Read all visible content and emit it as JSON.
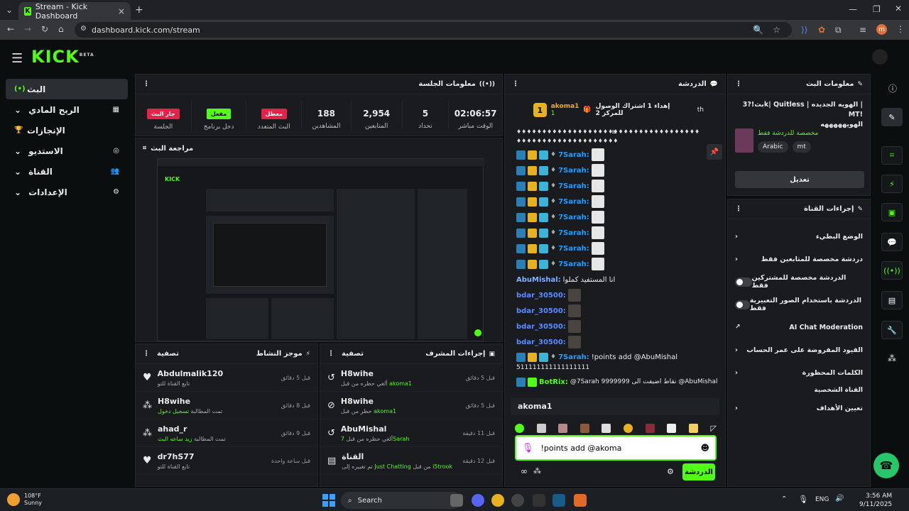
{
  "browser": {
    "tab_title": "Stream - Kick Dashboard",
    "url": "dashboard.kick.com/stream",
    "profile_initial": "m"
  },
  "logo": {
    "text": "KICK",
    "beta": "BETA"
  },
  "sidebar": {
    "items": [
      {
        "label": "البث",
        "icon": "(•)",
        "active": true
      },
      {
        "label": "الربح المادي",
        "icon": "▦",
        "expandable": true
      },
      {
        "label": "الإنجازات",
        "icon": "🏆",
        "expandable": false
      },
      {
        "label": "الاستديو",
        "icon": "◎",
        "expandable": true
      },
      {
        "label": "القناة",
        "icon": "👥",
        "expandable": true
      },
      {
        "label": "الإعدادات",
        "icon": "⚙",
        "expandable": true
      }
    ]
  },
  "session": {
    "title": "معلومات الجلسة",
    "stats": [
      {
        "value": "02:06:57",
        "label": "الوقت مباشر"
      },
      {
        "value": "5",
        "label": "تحداد"
      },
      {
        "value": "2,954",
        "label": "المتابعين"
      },
      {
        "value": "188",
        "label": "المشاهدين"
      }
    ],
    "badges": [
      {
        "badge": "معطل",
        "label": "البث المتعدد",
        "color": "#e5224a"
      },
      {
        "badge": "مفعل",
        "label": "دخل برنامج",
        "color": "#53fc18"
      },
      {
        "badge": "جار البث",
        "label": "الجلسة",
        "color": "#e5224a"
      }
    ]
  },
  "preview": {
    "title": "مراجعة البث"
  },
  "activity": {
    "title": "موجز النشاط",
    "filter": "تصفية",
    "items": [
      {
        "name": "Abdulmalik120",
        "sub": "تابع القناة للتو",
        "time": "قبل 5 دقائق",
        "icon": "heart-icon"
      },
      {
        "name": "H8wihe",
        "sub": "تمت المطالبة",
        "highlight": "تسجيل دخول",
        "time": "قبل 8 دقائق",
        "icon": "points-icon"
      },
      {
        "name": "ahad_r",
        "sub": "تمت المطالبة",
        "highlight": "زيد ساعه البث",
        "time": "قبل 9 دقائق",
        "icon": "points-icon"
      },
      {
        "name": "dr7hS77",
        "sub": "تابع القناة للتو",
        "time": "قبل ساعة واحدة",
        "icon": "heart-icon"
      }
    ]
  },
  "mod": {
    "title": "إجراءات المشرف",
    "filter": "تصفية",
    "items": [
      {
        "name": "H8wihe",
        "sub": "ألغي حظره من قبل",
        "who": "akoma1",
        "time": "قبل 5 دقائق",
        "icon": "undo-icon"
      },
      {
        "name": "H8wihe",
        "sub": "حظر من قبل",
        "who": "akoma1",
        "time": "قبل 5 دقائق",
        "icon": "ban-icon"
      },
      {
        "name": "AbuMishal",
        "sub": "ألغي حظره من قبل",
        "who": "7Sarah",
        "time": "قبل 11 دقيقة",
        "icon": "undo-icon"
      },
      {
        "name": "القناة",
        "sub": "تم تغييره إلى",
        "who": "Just Chatting",
        "who2": "i5trook",
        "mid": "من قبل",
        "time": "قبل 12 دقيقة",
        "icon": "category-icon"
      }
    ]
  },
  "chat": {
    "title": "الدردشة",
    "pinned": {
      "user": "akoma1",
      "count": "1",
      "text": "إهداء 1 اشتراك الوصول للمركز 2",
      "rank": "1",
      "suffix": "th"
    },
    "system_line": "♦♦♦♦♦♦♦♦♦♦♦♦♦♦♦♦♦♦♦♦♦♦♦♦♦♦♦♦♦♦♦♦♦♦♦♦♦♦♦♦♦♦♦♦♦♦♦♦♦♦♦",
    "system_line2": "♦♦♦♦♦♦♦♦♦♦♦♦♦♦♦♦♦♦♦♦",
    "sarah_user": "7Sarah:",
    "sarah_count": 8,
    "abumishal_user": "AbuMishal:",
    "abumishal_text": "انا المستفيد كملوا",
    "bdar_user": "bdar_30500:",
    "bdar_count": 4,
    "cmd_user": "7Sarah:",
    "cmd_text": "!points add @AbuMishal",
    "cmd_text2": "511111111111111111",
    "bot_user": "BotRix:",
    "bot_text": "@7Sarah 9999999 نقاط أضيفت الى @AbuMishal",
    "reply_to": "akoma1",
    "input_value": "!points add @akoma",
    "send_label": "الدردشة"
  },
  "stream_info": {
    "title": "معلومات البث",
    "stream_title": "بث!?3k| Quitless | الهويه الجديده | MT!",
    "stream_title2": "الهويهههههه",
    "category_label": "مخصصة للدردشة فقط",
    "tags": [
      "Arabic",
      "mt"
    ],
    "edit_label": "تعديل"
  },
  "channel_actions": {
    "title": "إجراءات القناة",
    "items": [
      {
        "label": "الوضع البطيء",
        "type": "chevron"
      },
      {
        "label": "دردشة مخصصة للمتابعين فقط",
        "type": "chevron"
      },
      {
        "label": "الدردشة مخصصة للمشتركين فقط",
        "type": "toggle"
      },
      {
        "label": "الدردشة باستخدام الصور التعبيرية فقط",
        "type": "toggle"
      },
      {
        "label": "AI Chat Moderation",
        "type": "external"
      },
      {
        "label": "القيود المفروضة على عمر الحساب",
        "type": "chevron"
      },
      {
        "label": "الكلمات المحظورة",
        "type": "chevron"
      }
    ],
    "section2": "القناة الشخصية",
    "goals": "تعيين الأهداف"
  },
  "taskbar": {
    "weather_temp": "108°F",
    "weather_text": "Sunny",
    "search": "Search",
    "lang": "ENG",
    "time": "3:56 AM",
    "date": "9/11/2025"
  },
  "colors": {
    "accent": "#53fc18",
    "panel": "#191b1f",
    "bg": "#0b0e0f",
    "red": "#e5224a"
  }
}
